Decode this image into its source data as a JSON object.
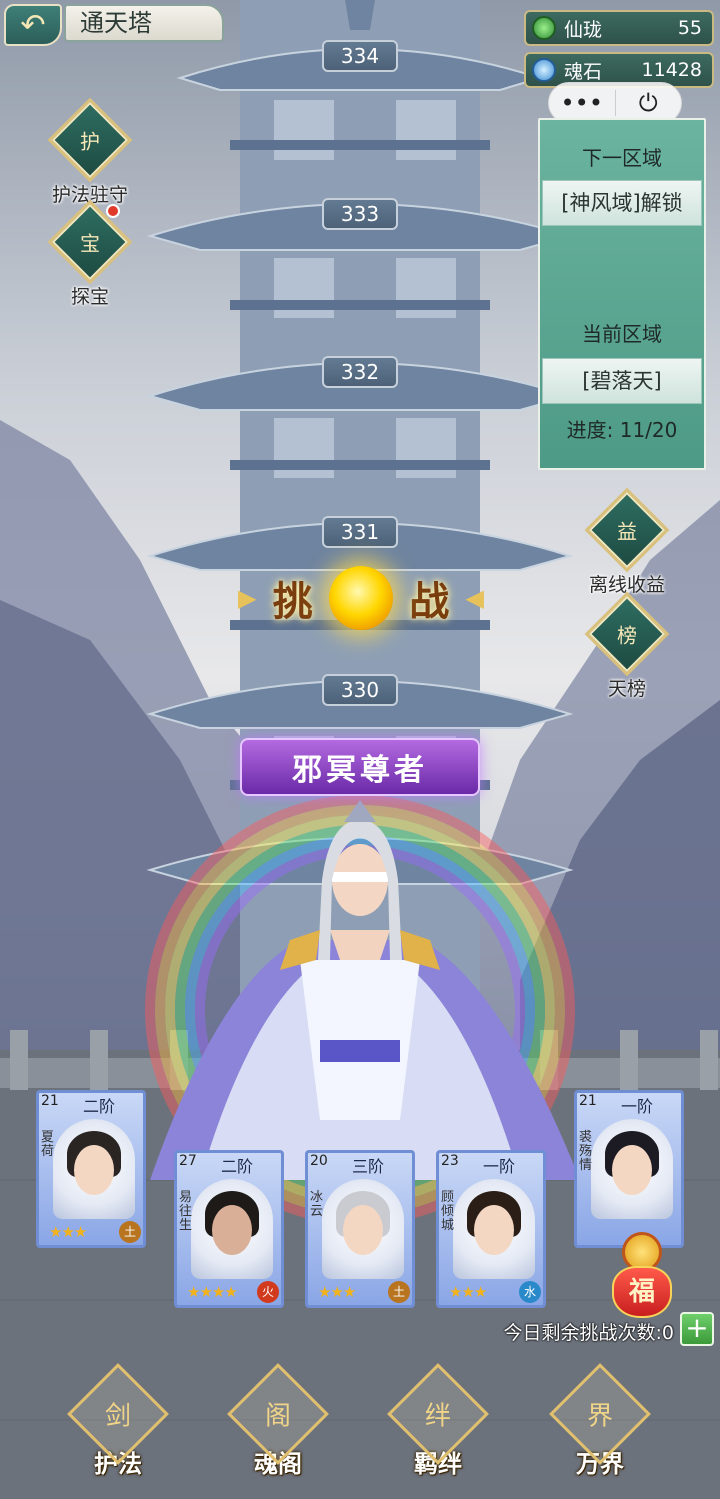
{
  "header": {
    "back_icon": "back-arrow-icon",
    "title": "通天塔"
  },
  "resources": [
    {
      "name": "仙珑",
      "value": "55",
      "icon": "jade-icon",
      "color": "#3fae43"
    },
    {
      "name": "魂石",
      "value": "11428",
      "icon": "soulstone-icon",
      "color": "#5fa8e6"
    }
  ],
  "capsule": {
    "more": "•••",
    "close": "⏻"
  },
  "left_menu": [
    {
      "label": "护法驻守",
      "icon": "guardian-icon",
      "glyph": "护",
      "badge": false
    },
    {
      "label": "探宝",
      "icon": "treasure-icon",
      "glyph": "宝",
      "badge": true
    }
  ],
  "region_panel": {
    "next_title": "下一区域",
    "next_region": "[神风域]解锁",
    "current_title": "当前区域",
    "current_region": "[碧落天]",
    "progress_label": "进度:",
    "progress": "11/20",
    "progress_value": [
      11,
      20
    ]
  },
  "right_menu": [
    {
      "label": "离线收益",
      "icon": "offline-reward-icon",
      "glyph": "益"
    },
    {
      "label": "天榜",
      "icon": "ranking-icon",
      "glyph": "榜"
    }
  ],
  "tower": {
    "floors": [
      "334",
      "333",
      "332",
      "331",
      "330"
    ],
    "challenge_left": "挑",
    "challenge_right": "战",
    "boss_name": "邪冥尊者"
  },
  "team": [
    {
      "level": "21",
      "rank": "二阶",
      "name": "夏荷",
      "stars": "★★★",
      "element": "土",
      "element_color": "#b9741f",
      "hair": "#2a2422"
    },
    {
      "level": "27",
      "rank": "二阶",
      "name": "易往生",
      "stars": "★★★★",
      "element": "火",
      "element_color": "#d23a1e",
      "hair": "#1e1a18"
    },
    {
      "level": "20",
      "rank": "三阶",
      "name": "冰云",
      "stars": "★★★",
      "element": "土",
      "element_color": "#b9741f",
      "hair": "#c9cbd0"
    },
    {
      "level": "23",
      "rank": "一阶",
      "name": "顾倾城",
      "stars": "★★★",
      "element": "水",
      "element_color": "#2a8ac9",
      "hair": "#2b1e16"
    },
    {
      "level": "21",
      "rank": "一阶",
      "name": "裘殇情",
      "stars": "",
      "element": "",
      "element_color": "#2a8ac9",
      "hair": "#1c1a22"
    }
  ],
  "fortune_badge": "福",
  "remaining_challenges": "今日剩余挑战次数:0",
  "add_button": "+",
  "bottom_nav": [
    {
      "label": "护法",
      "icon": "sword-emblem-icon",
      "glyph": "剑"
    },
    {
      "label": "魂阁",
      "icon": "pavilion-emblem-icon",
      "glyph": "阁"
    },
    {
      "label": "羁绊",
      "icon": "bond-emblem-icon",
      "glyph": "绊"
    },
    {
      "label": "万界",
      "icon": "book-emblem-icon",
      "glyph": "界"
    }
  ]
}
